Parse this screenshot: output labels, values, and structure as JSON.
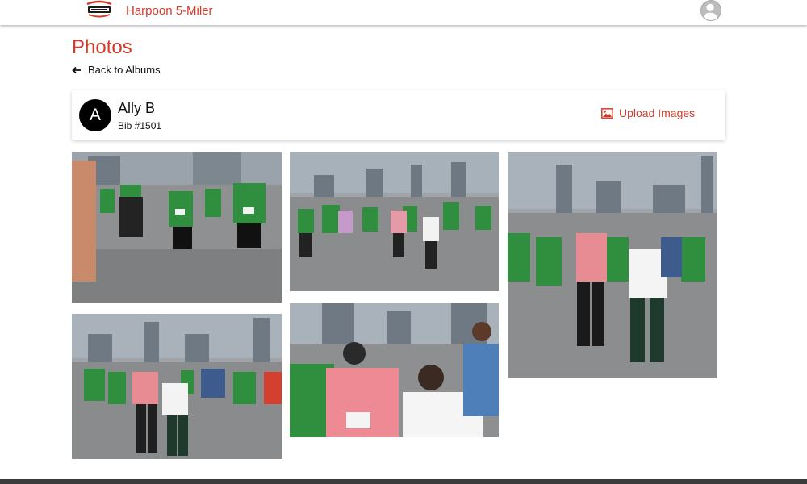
{
  "header": {
    "brand_title": "Harpoon 5-Miler",
    "logo_icon": "harpoon-logo-icon",
    "account_icon": "user-avatar-icon"
  },
  "page": {
    "title": "Photos",
    "back_label": "Back to Albums",
    "back_icon": "arrow-left-icon"
  },
  "profile": {
    "initial": "A",
    "name": "Ally B",
    "bib": "Bib #1501",
    "upload_label": "Upload Images",
    "upload_icon": "image-icon"
  },
  "photos": [
    {
      "id": 1,
      "alt": "Runners in green shirts on a city street"
    },
    {
      "id": 2,
      "alt": "Pack of runners with city skyline"
    },
    {
      "id": 3,
      "alt": "Runners approaching camera near skyline"
    },
    {
      "id": 4,
      "alt": "Group of runners on road with buildings"
    },
    {
      "id": 5,
      "alt": "Runner wearing bib 1501 in pink shirt"
    }
  ],
  "colors": {
    "accent": "#d43a2a",
    "shirt_green": "#2f8f3e",
    "footer": "#3b3b3b"
  }
}
